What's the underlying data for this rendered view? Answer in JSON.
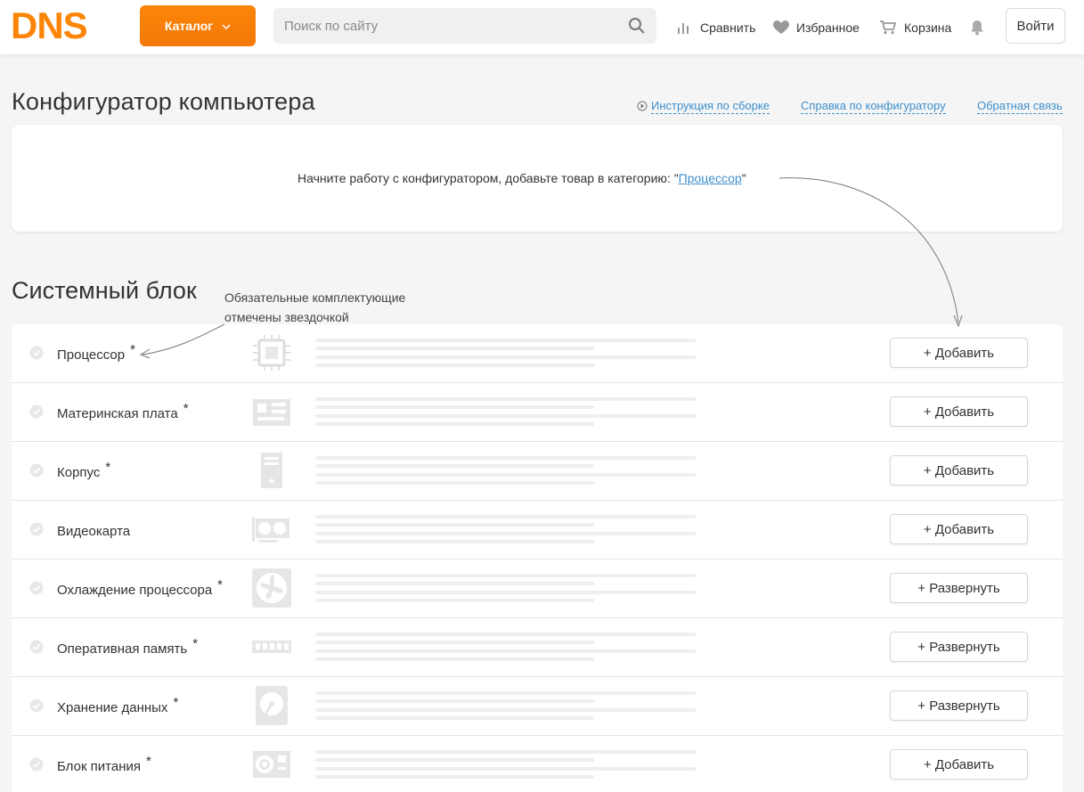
{
  "header": {
    "logo_text": "DNS",
    "brand_color": "#fc8507",
    "catalog_label": "Каталог",
    "search_placeholder": "Поиск по сайту",
    "compare_label": "Сравнить",
    "favorites_label": "Избранное",
    "cart_label": "Корзина",
    "login_label": "Войти"
  },
  "page": {
    "title": "Конфигуратор компьютера",
    "links": {
      "instruction": "Инструкция по сборке",
      "help": "Справка по конфигуратору",
      "feedback": "Обратная связь"
    },
    "link_color": "#3c8fcd"
  },
  "hint": {
    "text_before": "Начните работу с конфигуратором, добавьте товар в категорию: \"",
    "link": "Процессор",
    "text_after": "\""
  },
  "section": {
    "title": "Системный блок",
    "note_line1": "Обязательные комплектующие",
    "note_line2": "отмечены звездочкой"
  },
  "rows": [
    {
      "label": "Процессор",
      "required": "*",
      "icon": "cpu-icon",
      "button": "+ Добавить"
    },
    {
      "label": "Материнская плата",
      "required": "*",
      "icon": "motherboard-icon",
      "button": "+ Добавить"
    },
    {
      "label": "Корпус",
      "required": "*",
      "icon": "case-icon",
      "button": "+ Добавить"
    },
    {
      "label": "Видеокарта",
      "required": "",
      "icon": "gpu-icon",
      "button": "+ Добавить"
    },
    {
      "label": "Охлаждение процессора",
      "required": "*",
      "icon": "fan-icon",
      "button": "+ Развернуть"
    },
    {
      "label": "Оперативная память",
      "required": "*",
      "icon": "ram-icon",
      "button": "+ Развернуть"
    },
    {
      "label": "Хранение данных",
      "required": "*",
      "icon": "hdd-icon",
      "button": "+ Развернуть"
    },
    {
      "label": "Блок питания",
      "required": "*",
      "icon": "psu-icon",
      "button": "+ Добавить"
    }
  ]
}
